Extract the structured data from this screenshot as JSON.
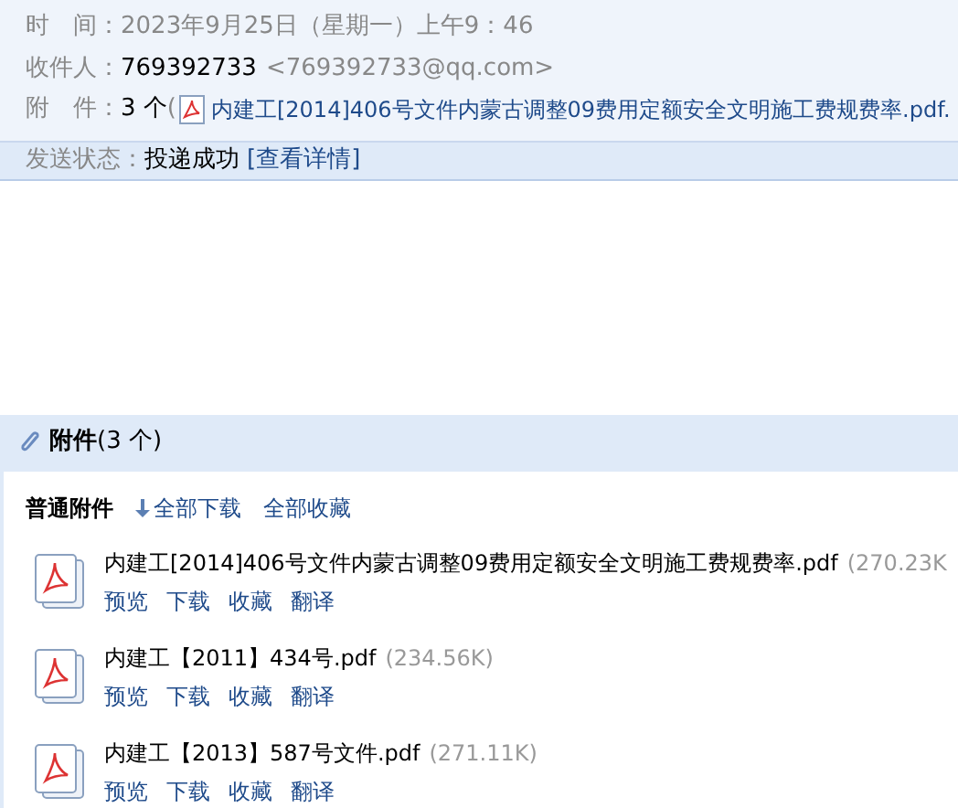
{
  "header": {
    "time": {
      "label": "时　间：",
      "value": "2023年9月25日（星期一）上午9：46"
    },
    "recipient": {
      "label": "收件人：",
      "name": "769392733",
      "address": "<769392733@qq.com>"
    },
    "attachments": {
      "label": "附　件：",
      "count": "3 个",
      "open": "(",
      "first_file": "内建工[2014]406号文件内蒙古调整09费用定额安全文明施工费规费率.pdf."
    }
  },
  "status": {
    "label": "发送状态：",
    "value": "投递成功",
    "link": "[查看详情]"
  },
  "attachment_panel": {
    "title": "附件",
    "count": "(3 个)",
    "group": "普通附件",
    "download_all": "全部下载",
    "save_all": "全部收藏",
    "files": [
      {
        "name": "内建工[2014]406号文件内蒙古调整09费用定额安全文明施工费规费率.pdf",
        "size": "(270.23K",
        "actions": [
          "预览",
          "下载",
          "收藏",
          "翻译"
        ]
      },
      {
        "name": "内建工【2011】434号.pdf",
        "size": "(234.56K)",
        "actions": [
          "预览",
          "下载",
          "收藏",
          "翻译"
        ]
      },
      {
        "name": "内建工【2013】587号文件.pdf",
        "size": "(271.11K)",
        "actions": [
          "预览",
          "下载",
          "收藏",
          "翻译"
        ]
      }
    ]
  }
}
